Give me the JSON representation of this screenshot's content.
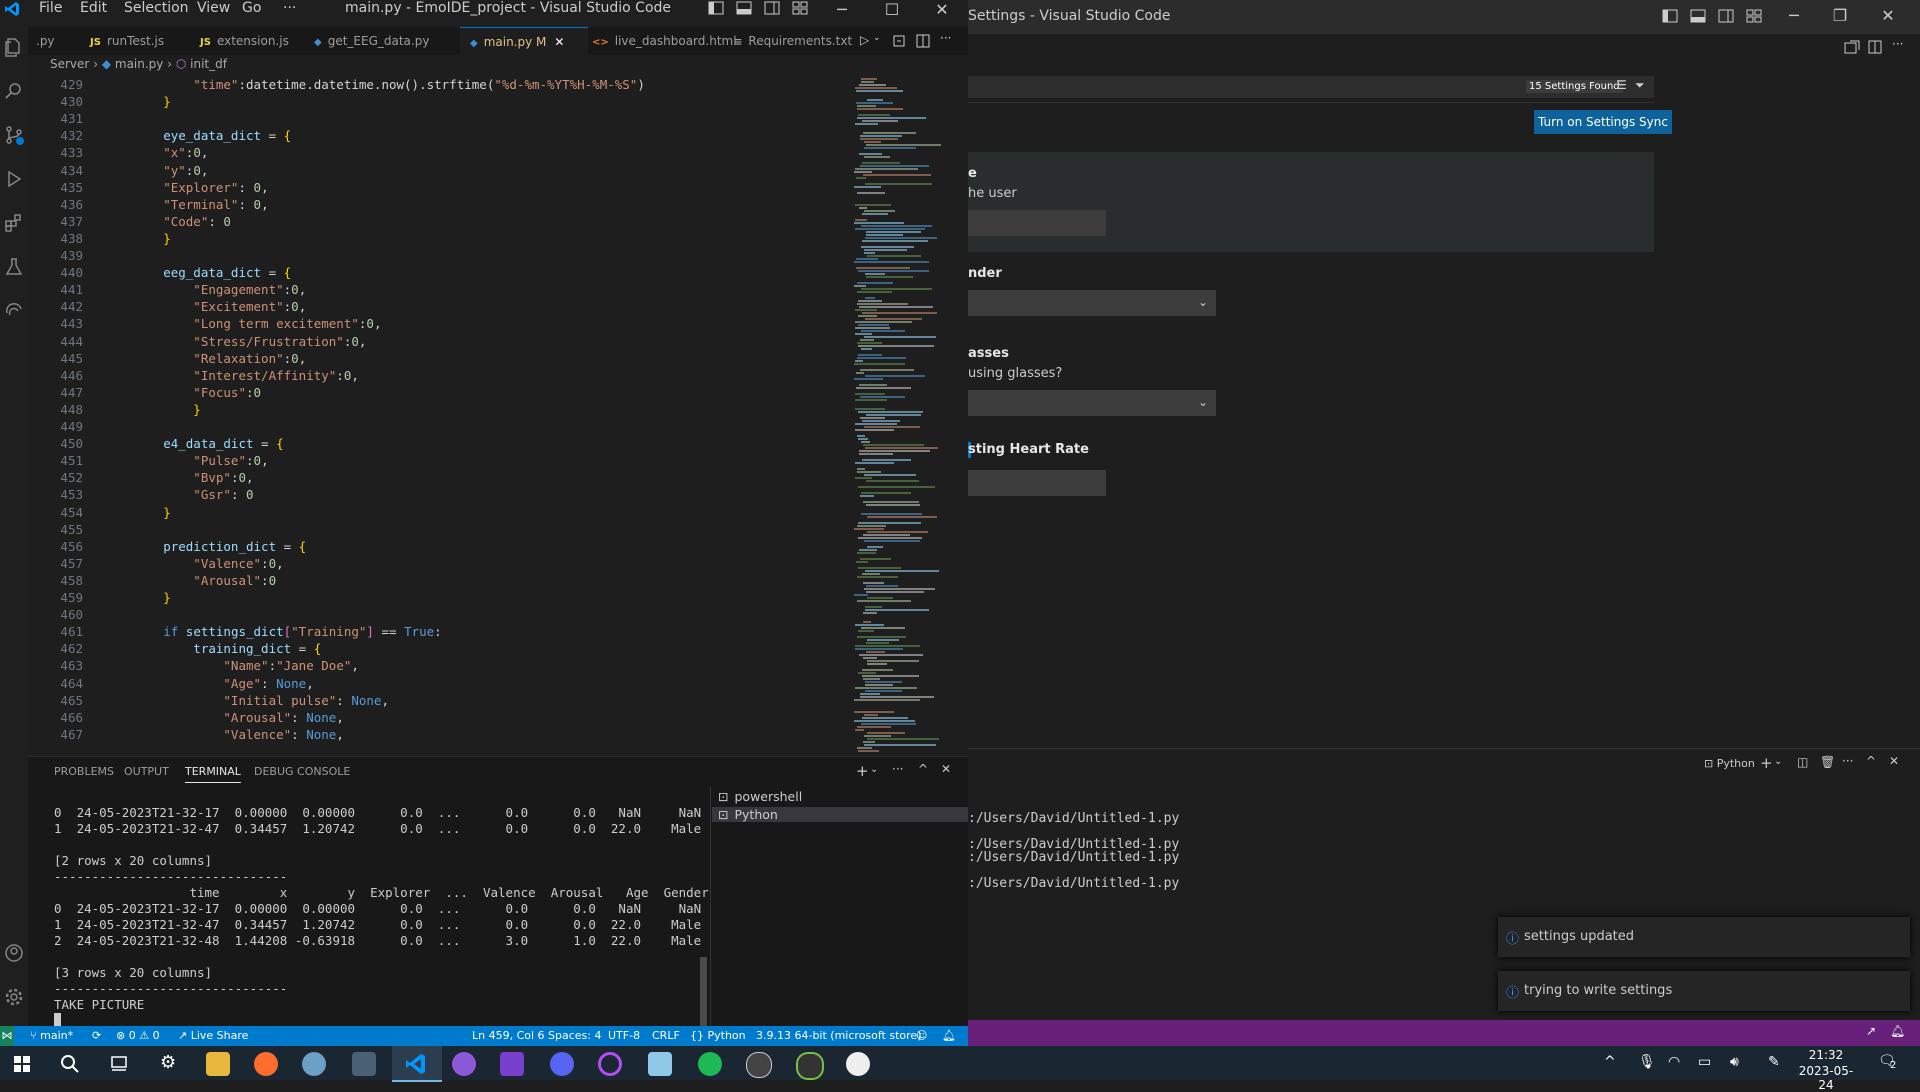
{
  "left_window": {
    "title": "main.py - EmoIDE_project - Visual Studio Code",
    "menu": [
      "File",
      "Edit",
      "Selection",
      "View",
      "Go",
      "···"
    ],
    "tabs": [
      {
        "label": ".py",
        "icon": ""
      },
      {
        "label": "runTest.js",
        "icon": "JS"
      },
      {
        "label": "extension.js",
        "icon": "JS"
      },
      {
        "label": "get_EEG_data.py",
        "icon": "py"
      },
      {
        "label": "main.py M",
        "icon": "py"
      },
      {
        "label": "live_dashboard.html",
        "icon": "<>"
      },
      {
        "label": "Requirements.txt",
        "icon": "≡"
      }
    ],
    "breadcrumb": {
      "folder": "Server",
      "file": "main.py",
      "symbol": "init_df"
    },
    "code": [
      {
        "n": "429",
        "tokens": [
          [
            "s",
            "            \"time\""
          ],
          [
            "t",
            ":datetime.datetime.now().strftime("
          ],
          [
            "s",
            "\"%d-%m-%YT%H-%M-%S\""
          ],
          [
            "t",
            ")"
          ]
        ]
      },
      {
        "n": "430",
        "tokens": [
          [
            "br",
            "        }"
          ]
        ]
      },
      {
        "n": "431",
        "tokens": []
      },
      {
        "n": "432",
        "tokens": [
          [
            "v",
            "        eye_data_dict"
          ],
          [
            "t",
            " = "
          ],
          [
            "br",
            "{"
          ]
        ]
      },
      {
        "n": "433",
        "tokens": [
          [
            "s",
            "        \"x\""
          ],
          [
            "t",
            ":"
          ],
          [
            "n",
            "0"
          ],
          [
            "t",
            ","
          ]
        ]
      },
      {
        "n": "434",
        "tokens": [
          [
            "s",
            "        \"y\""
          ],
          [
            "t",
            ":"
          ],
          [
            "n",
            "0"
          ],
          [
            "t",
            ","
          ]
        ]
      },
      {
        "n": "435",
        "tokens": [
          [
            "s",
            "        \"Explorer\""
          ],
          [
            "t",
            ": "
          ],
          [
            "n",
            "0"
          ],
          [
            "t",
            ","
          ]
        ]
      },
      {
        "n": "436",
        "tokens": [
          [
            "s",
            "        \"Terminal\""
          ],
          [
            "t",
            ": "
          ],
          [
            "n",
            "0"
          ],
          [
            "t",
            ","
          ]
        ]
      },
      {
        "n": "437",
        "tokens": [
          [
            "s",
            "        \"Code\""
          ],
          [
            "t",
            ": "
          ],
          [
            "n",
            "0"
          ]
        ]
      },
      {
        "n": "438",
        "tokens": [
          [
            "br",
            "        }"
          ]
        ]
      },
      {
        "n": "439",
        "tokens": []
      },
      {
        "n": "440",
        "tokens": [
          [
            "v",
            "        eeg_data_dict"
          ],
          [
            "t",
            " = "
          ],
          [
            "br",
            "{"
          ]
        ]
      },
      {
        "n": "441",
        "tokens": [
          [
            "s",
            "            \"Engagement\""
          ],
          [
            "t",
            ":"
          ],
          [
            "n",
            "0"
          ],
          [
            "t",
            ","
          ]
        ]
      },
      {
        "n": "442",
        "tokens": [
          [
            "s",
            "            \"Excitement\""
          ],
          [
            "t",
            ":"
          ],
          [
            "n",
            "0"
          ],
          [
            "t",
            ","
          ]
        ]
      },
      {
        "n": "443",
        "tokens": [
          [
            "s",
            "            \"Long term excitement\""
          ],
          [
            "t",
            ":"
          ],
          [
            "n",
            "0"
          ],
          [
            "t",
            ","
          ]
        ]
      },
      {
        "n": "444",
        "tokens": [
          [
            "s",
            "            \"Stress/Frustration\""
          ],
          [
            "t",
            ":"
          ],
          [
            "n",
            "0"
          ],
          [
            "t",
            ","
          ]
        ]
      },
      {
        "n": "445",
        "tokens": [
          [
            "s",
            "            \"Relaxation\""
          ],
          [
            "t",
            ":"
          ],
          [
            "n",
            "0"
          ],
          [
            "t",
            ","
          ]
        ]
      },
      {
        "n": "446",
        "tokens": [
          [
            "s",
            "            \"Interest/Affinity\""
          ],
          [
            "t",
            ":"
          ],
          [
            "n",
            "0"
          ],
          [
            "t",
            ","
          ]
        ]
      },
      {
        "n": "447",
        "tokens": [
          [
            "s",
            "            \"Focus\""
          ],
          [
            "t",
            ":"
          ],
          [
            "n",
            "0"
          ]
        ]
      },
      {
        "n": "448",
        "tokens": [
          [
            "br",
            "            }"
          ]
        ]
      },
      {
        "n": "449",
        "tokens": []
      },
      {
        "n": "450",
        "tokens": [
          [
            "v",
            "        e4_data_dict"
          ],
          [
            "t",
            " = "
          ],
          [
            "br",
            "{"
          ]
        ]
      },
      {
        "n": "451",
        "tokens": [
          [
            "s",
            "            \"Pulse\""
          ],
          [
            "t",
            ":"
          ],
          [
            "n",
            "0"
          ],
          [
            "t",
            ","
          ]
        ]
      },
      {
        "n": "452",
        "tokens": [
          [
            "s",
            "            \"Bvp\""
          ],
          [
            "t",
            ":"
          ],
          [
            "n",
            "0"
          ],
          [
            "t",
            ","
          ]
        ]
      },
      {
        "n": "453",
        "tokens": [
          [
            "s",
            "            \"Gsr\""
          ],
          [
            "t",
            ": "
          ],
          [
            "n",
            "0"
          ]
        ]
      },
      {
        "n": "454",
        "tokens": [
          [
            "br",
            "        }"
          ]
        ]
      },
      {
        "n": "455",
        "tokens": []
      },
      {
        "n": "456",
        "tokens": [
          [
            "v",
            "        prediction_dict"
          ],
          [
            "t",
            " = "
          ],
          [
            "br",
            "{"
          ]
        ]
      },
      {
        "n": "457",
        "tokens": [
          [
            "s",
            "            \"Valence\""
          ],
          [
            "t",
            ":"
          ],
          [
            "n",
            "0"
          ],
          [
            "t",
            ","
          ]
        ]
      },
      {
        "n": "458",
        "tokens": [
          [
            "s",
            "            \"Arousal\""
          ],
          [
            "t",
            ":"
          ],
          [
            "n",
            "0"
          ]
        ]
      },
      {
        "n": "459",
        "tokens": [
          [
            "br",
            "        }"
          ]
        ]
      },
      {
        "n": "460",
        "tokens": []
      },
      {
        "n": "461",
        "tokens": [
          [
            "k",
            "        if"
          ],
          [
            "v",
            " settings_dict"
          ],
          [
            "br2",
            "["
          ],
          [
            "s",
            "\"Training\""
          ],
          [
            "br2",
            "]"
          ],
          [
            "t",
            " == "
          ],
          [
            "k",
            "True"
          ],
          [
            "t",
            ":"
          ]
        ]
      },
      {
        "n": "462",
        "tokens": [
          [
            "v",
            "            training_dict"
          ],
          [
            "t",
            " = "
          ],
          [
            "br",
            "{"
          ]
        ]
      },
      {
        "n": "463",
        "tokens": [
          [
            "s",
            "                \"Name\""
          ],
          [
            "t",
            ":"
          ],
          [
            "s",
            "\"Jane Doe\""
          ],
          [
            "t",
            ","
          ]
        ]
      },
      {
        "n": "464",
        "tokens": [
          [
            "s",
            "                \"Age\""
          ],
          [
            "t",
            ": "
          ],
          [
            "k",
            "None"
          ],
          [
            "t",
            ","
          ]
        ]
      },
      {
        "n": "465",
        "tokens": [
          [
            "s",
            "                \"Initial pulse\""
          ],
          [
            "t",
            ": "
          ],
          [
            "k",
            "None"
          ],
          [
            "t",
            ","
          ]
        ]
      },
      {
        "n": "466",
        "tokens": [
          [
            "s",
            "                \"Arousal\""
          ],
          [
            "t",
            ": "
          ],
          [
            "k",
            "None"
          ],
          [
            "t",
            ","
          ]
        ]
      },
      {
        "n": "467",
        "tokens": [
          [
            "s",
            "                \"Valence\""
          ],
          [
            "t",
            ": "
          ],
          [
            "k",
            "None"
          ],
          [
            "t",
            ","
          ]
        ]
      }
    ],
    "panel_tabs": [
      "PROBLEMS",
      "OUTPUT",
      "TERMINAL",
      "DEBUG CONSOLE"
    ],
    "terminal_lines": [
      "0  24-05-2023T21-32-17  0.00000  0.00000      0.0  ...      0.0      0.0   NaN     NaN",
      "1  24-05-2023T21-32-47  0.34457  1.20742      0.0  ...      0.0      0.0  22.0    Male",
      "",
      "[2 rows x 20 columns]",
      "-------------------------------",
      "                  time        x        y  Explorer  ...  Valence  Arousal   Age  Gender",
      "0  24-05-2023T21-32-17  0.00000  0.00000      0.0  ...      0.0      0.0   NaN     NaN",
      "1  24-05-2023T21-32-47  0.34457  1.20742      0.0  ...      0.0      0.0  22.0    Male",
      "2  24-05-2023T21-32-48  1.44208 -0.63918      0.0  ...      3.0      1.0  22.0    Male",
      "",
      "[3 rows x 20 columns]",
      "-------------------------------",
      "TAKE PICTURE"
    ],
    "terminal_list": [
      "powershell",
      "Python"
    ],
    "status": {
      "branch": "main*",
      "problems": "⊗ 0 ⚠ 0",
      "liveshare": "Live Share",
      "position": "Ln 459, Col 6",
      "spaces": "Spaces: 4",
      "encoding": "UTF-8",
      "eol": "CRLF",
      "language": "Python",
      "interpreter": "3.9.13 64-bit (microsoft store)"
    }
  },
  "right_window": {
    "title": "Settings - Visual Studio Code",
    "settings_found": "15 Settings Found",
    "sync_button": "Turn on Settings Sync",
    "settings": [
      {
        "title": "e",
        "desc": "he user"
      },
      {
        "title": "nder",
        "desc": ""
      },
      {
        "title": "asses",
        "desc": "using glasses?"
      },
      {
        "title": "sting Heart Rate",
        "desc": ""
      }
    ],
    "panel_label": "Python",
    "terminal_lines": [
      ":/Users/David/Untitled-1.py",
      ":/Users/David/Untitled-1.py",
      ":/Users/David/Untitled-1.py",
      ":/Users/David/Untitled-1.py"
    ],
    "toasts": [
      "settings updated",
      "trying to write settings"
    ]
  },
  "taskbar": {
    "time": "21:32",
    "date": "2023-05-24",
    "notifications": "2"
  }
}
